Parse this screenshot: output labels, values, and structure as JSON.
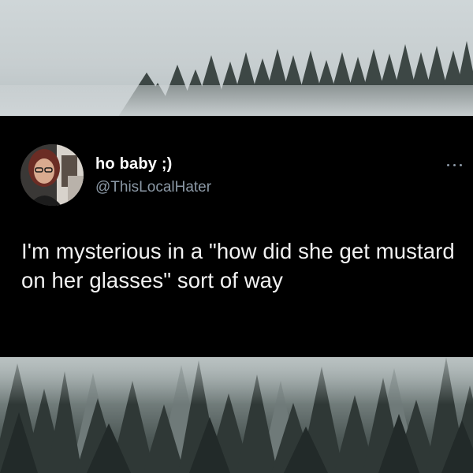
{
  "tweet": {
    "display_name": "ho baby ;)",
    "handle": "@ThisLocalHater",
    "text": "I'm mysterious in a \"how did she get mustard on her glasses\" sort of way",
    "more_icon": "more-horizontal-icon"
  },
  "background": {
    "top_photo": "misty-pine-forest",
    "bottom_photo": "misty-pine-forest"
  }
}
